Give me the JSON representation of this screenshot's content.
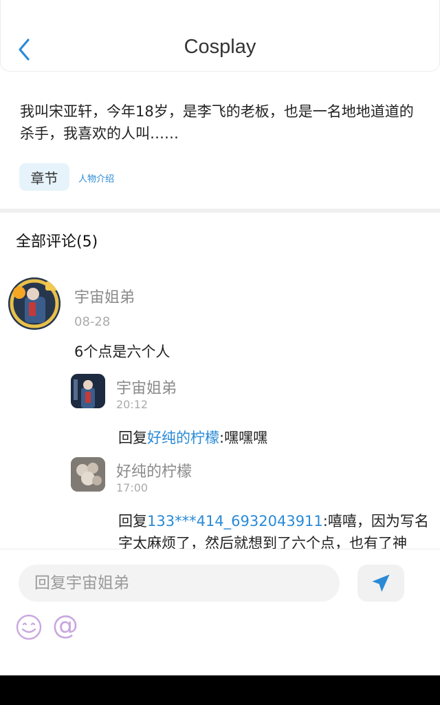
{
  "header": {
    "title": "Cosplay"
  },
  "intro": {
    "text": "我叫宋亚轩，今年18岁，是李飞的老板，也是一名地地道道的杀手，我喜欢的人叫……"
  },
  "tags": {
    "chapter": "章节",
    "characters": "人物介绍"
  },
  "comments": {
    "title": "全部评论(5)",
    "main": {
      "author": "宇宙姐弟",
      "date": "08-28",
      "text": "6个点是六个人"
    },
    "replies": [
      {
        "author": "宇宙姐弟",
        "time": "20:12",
        "prefix": "回复",
        "target": "好纯的柠檬",
        "separator": ":",
        "text": "嘿嘿嘿"
      },
      {
        "author": "好纯的柠檬",
        "time": "17:00",
        "prefix": "回复",
        "target": "133***414_6932043911",
        "separator": ":",
        "line1": "嘻嘻，因为写名",
        "line2": "字太麻烦了，然后就想到了六个点，也有了神"
      }
    ]
  },
  "footer": {
    "placeholder": "回复宇宙姐弟"
  },
  "colors": {
    "accent": "#2a8ad6",
    "chip_bg": "#e6f3fb",
    "emoji": "#c9a7df"
  },
  "icons": {
    "back": "chevron-left-icon",
    "send": "send-icon",
    "emoji": "smiley-icon",
    "mention": "at-icon"
  }
}
